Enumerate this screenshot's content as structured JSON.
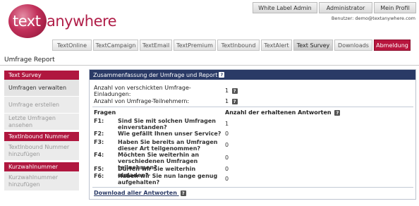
{
  "logo": {
    "part1": "text",
    "part2": "anywhere"
  },
  "account": {
    "white_label": "White Label Admin",
    "admin": "Administrator",
    "profile": "Mein Profil",
    "user_line": "Benutzer: demo@textanywhere.com"
  },
  "nav": {
    "tabs": [
      "TextOnline",
      "TextCampaign",
      "TextEmail",
      "TextPremium",
      "TextInbound",
      "TextAlert",
      "Text Survey",
      "Downloads",
      "Abmeldung"
    ],
    "active": "Text Survey"
  },
  "page_title": "Umfrage Report",
  "sidebar": {
    "sections": [
      {
        "title": "Text Survey",
        "items": [
          "Umfragen verwalten",
          "Umfrage erstellen",
          "Letzte Umfragen ansehen"
        ]
      },
      {
        "title": "TextInbound Nummer",
        "items": [
          "TextInbound Nummer hinzufügen"
        ]
      },
      {
        "title": "Kurzwahlnummer",
        "items": [
          "Kurzwahlnummer hinzufügen"
        ]
      }
    ]
  },
  "panel": {
    "title": "Zusammenfassung der Umfrage und Report",
    "sent_label": "Anzahl von verschickten Umfrage-Einladungen:",
    "sent_value": "1",
    "participants_label": "Anzahl von Umfrage-Teilnehmern:",
    "participants_value": "1",
    "questions_header": "Fragen",
    "answers_header": "Anzahl der erhaltenen Antworten",
    "questions": [
      {
        "id": "F1:",
        "text": "Sind Sie mit solchen Umfragen einverstanden?",
        "count": "1"
      },
      {
        "id": "F2:",
        "text": "Wie gefällt Ihnen unser Service?",
        "count": "0"
      },
      {
        "id": "F3:",
        "text": "Haben Sie bereits an Umfragen dieser Art teilgenommen?",
        "count": "0"
      },
      {
        "id": "F4:",
        "text": "Möchten Sie weiterhin an verschiedenen Umfragen teilnehmen?",
        "count": "0"
      },
      {
        "id": "F5:",
        "text": "Dürfen wir Sie weiterhin einladen?",
        "count": "0"
      },
      {
        "id": "F6:",
        "text": "Haben wir Sie nun lange genug aufgehalten?",
        "count": "0"
      }
    ],
    "download_label": "Download aller Antworten"
  },
  "help_glyph": "?",
  "colors": {
    "brand": "#b0173f",
    "panel_header": "#2a3a66"
  }
}
